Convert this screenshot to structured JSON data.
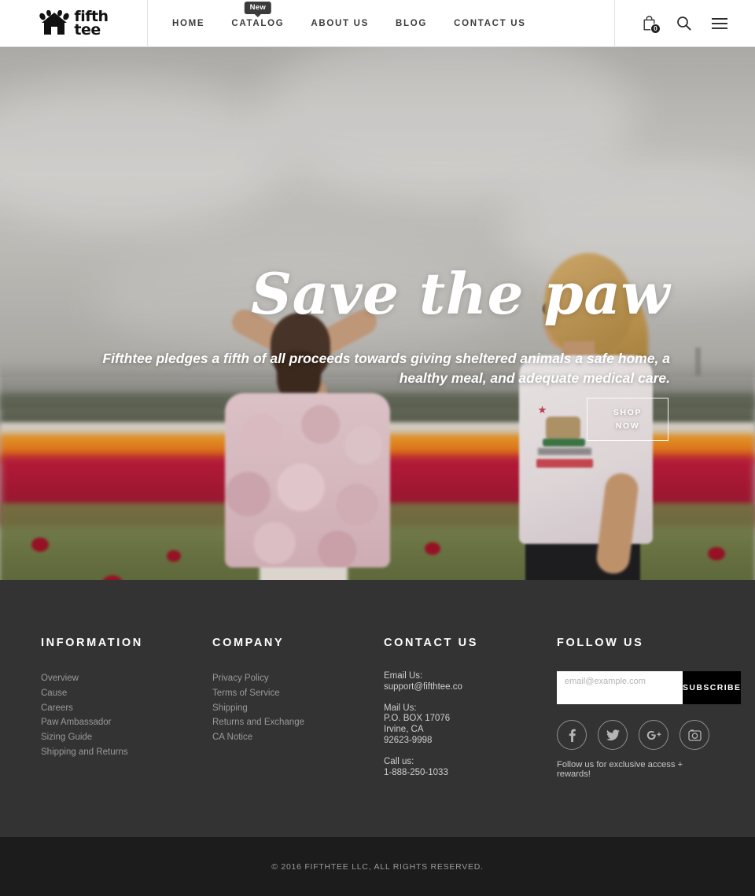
{
  "header": {
    "logo": {
      "icon": "paw-house-logo-icon",
      "line1": "fifth",
      "line2": "tee"
    },
    "nav": [
      {
        "label": "HOME",
        "badge": null
      },
      {
        "label": "CATALOG",
        "badge": "New"
      },
      {
        "label": "ABOUT US",
        "badge": null
      },
      {
        "label": "BLOG",
        "badge": null
      },
      {
        "label": "CONTACT US",
        "badge": null
      }
    ],
    "utils": {
      "cart_icon": "shopping-bag-icon",
      "cart_count": "0",
      "search_icon": "search-icon",
      "menu_icon": "hamburger-menu-icon"
    }
  },
  "hero": {
    "title": "Save the paw",
    "subtitle": "Fifthtee pledges a fifth of all proceeds towards giving sheltered animals a safe home, a healthy meal, and adequate medical care.",
    "cta_line1": "SHOP",
    "cta_line2": "NOW"
  },
  "footer": {
    "information": {
      "heading": "INFORMATION",
      "links": [
        "Overview",
        "Cause",
        "Careers",
        "Paw Ambassador",
        "Sizing Guide",
        "Shipping and Returns"
      ]
    },
    "company": {
      "heading": "COMPANY",
      "links": [
        "Privacy Policy",
        "Terms of Service",
        "Shipping",
        "Returns and Exchange",
        "CA Notice"
      ]
    },
    "contact": {
      "heading": "CONTACT US",
      "email_label": "Email Us:",
      "email_value": "support@fifthtee.co",
      "mail_label": "Mail Us:",
      "mail_line1": "P.O. BOX 17076",
      "mail_line2": "Irvine, CA",
      "mail_line3": "92623-9998",
      "call_label": "Call us:",
      "call_value": "1-888-250-1033"
    },
    "follow": {
      "heading": "FOLLOW US",
      "email_placeholder": "email@example.com",
      "email_value": "",
      "subscribe_label": "SUBSCRIBE",
      "socials": [
        "facebook-icon",
        "twitter-icon",
        "google-plus-icon",
        "instagram-icon"
      ],
      "note": "Follow us for exclusive access + rewards!"
    }
  },
  "copyright": {
    "text": "© 2016 FIFTHTEE LLC, ALL RIGHTS RESERVED."
  },
  "colors": {
    "footer_bg": "#333333",
    "copyright_bg": "#1c1c1c",
    "subscribe_bg": "#000000",
    "badge_bg": "#3b3b3b"
  }
}
